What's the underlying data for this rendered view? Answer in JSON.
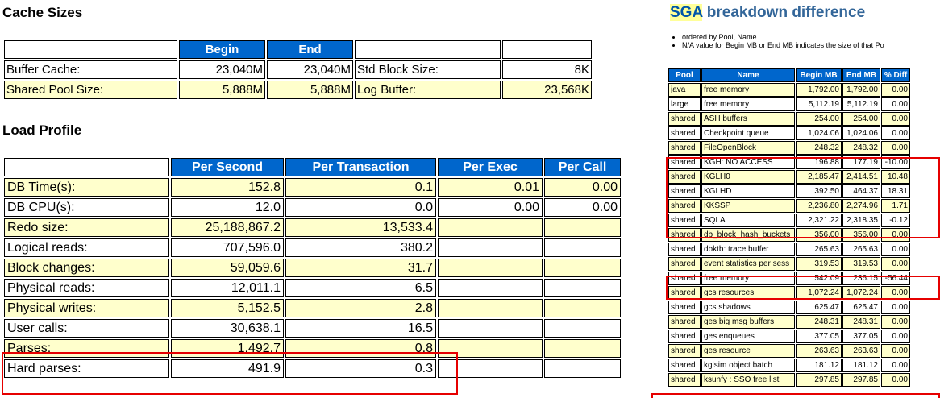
{
  "cache_sizes": {
    "title": "Cache Sizes",
    "headers": [
      "Begin",
      "End"
    ],
    "rows": [
      {
        "label": "Buffer Cache:",
        "begin": "23,040M",
        "end": "23,040M",
        "label2": "Std Block Size:",
        "value2": "8K",
        "shade": "w"
      },
      {
        "label": "Shared Pool Size:",
        "begin": "5,888M",
        "end": "5,888M",
        "label2": "Log Buffer:",
        "value2": "23,568K",
        "shade": "y"
      }
    ]
  },
  "load_profile": {
    "title": "Load Profile",
    "headers": [
      "Per Second",
      "Per Transaction",
      "Per Exec",
      "Per Call"
    ],
    "rows": [
      {
        "label": "DB Time(s):",
        "per_second": "152.8",
        "per_txn": "0.1",
        "per_exec": "0.01",
        "per_call": "0.00",
        "shade": "y"
      },
      {
        "label": "DB CPU(s):",
        "per_second": "12.0",
        "per_txn": "0.0",
        "per_exec": "0.00",
        "per_call": "0.00",
        "shade": "w"
      },
      {
        "label": "Redo size:",
        "per_second": "25,188,867.2",
        "per_txn": "13,533.4",
        "per_exec": "",
        "per_call": "",
        "shade": "y"
      },
      {
        "label": "Logical reads:",
        "per_second": "707,596.0",
        "per_txn": "380.2",
        "per_exec": "",
        "per_call": "",
        "shade": "w"
      },
      {
        "label": "Block changes:",
        "per_second": "59,059.6",
        "per_txn": "31.7",
        "per_exec": "",
        "per_call": "",
        "shade": "y"
      },
      {
        "label": "Physical reads:",
        "per_second": "12,011.1",
        "per_txn": "6.5",
        "per_exec": "",
        "per_call": "",
        "shade": "w"
      },
      {
        "label": "Physical writes:",
        "per_second": "5,152.5",
        "per_txn": "2.8",
        "per_exec": "",
        "per_call": "",
        "shade": "y"
      },
      {
        "label": "User calls:",
        "per_second": "30,638.1",
        "per_txn": "16.5",
        "per_exec": "",
        "per_call": "",
        "shade": "w"
      },
      {
        "label": "Parses:",
        "per_second": "1,492.7",
        "per_txn": "0.8",
        "per_exec": "",
        "per_call": "",
        "shade": "y"
      },
      {
        "label": "Hard parses:",
        "per_second": "491.9",
        "per_txn": "0.3",
        "per_exec": "",
        "per_call": "",
        "shade": "w"
      }
    ]
  },
  "sga_breakdown": {
    "title_highlight": "SGA",
    "title_rest": " breakdown difference",
    "notes": [
      "ordered by Pool, Name",
      "N/A value for Begin MB or End MB indicates the size of that Po"
    ],
    "headers": [
      "Pool",
      "Name",
      "Begin MB",
      "End MB",
      "% Diff"
    ],
    "rows": [
      {
        "pool": "java",
        "name": "free memory",
        "begin": "1,792.00",
        "end": "1,792.00",
        "diff": "0.00",
        "shade": "y"
      },
      {
        "pool": "large",
        "name": "free memory",
        "begin": "5,112.19",
        "end": "5,112.19",
        "diff": "0.00",
        "shade": "w"
      },
      {
        "pool": "shared",
        "name": "ASH buffers",
        "begin": "254.00",
        "end": "254.00",
        "diff": "0.00",
        "shade": "y"
      },
      {
        "pool": "shared",
        "name": "Checkpoint queue",
        "begin": "1,024.06",
        "end": "1,024.06",
        "diff": "0.00",
        "shade": "w"
      },
      {
        "pool": "shared",
        "name": "FileOpenBlock",
        "begin": "248.32",
        "end": "248.32",
        "diff": "0.00",
        "shade": "y"
      },
      {
        "pool": "shared",
        "name": "KGH: NO ACCESS",
        "begin": "196.88",
        "end": "177.19",
        "diff": "-10.00",
        "shade": "w"
      },
      {
        "pool": "shared",
        "name": "KGLH0",
        "begin": "2,185.47",
        "end": "2,414.51",
        "diff": "10.48",
        "shade": "y"
      },
      {
        "pool": "shared",
        "name": "KGLHD",
        "begin": "392.50",
        "end": "464.37",
        "diff": "18.31",
        "shade": "w"
      },
      {
        "pool": "shared",
        "name": "KKSSP",
        "begin": "2,236.80",
        "end": "2,274.96",
        "diff": "1.71",
        "shade": "y"
      },
      {
        "pool": "shared",
        "name": "SQLA",
        "begin": "2,321.22",
        "end": "2,318.35",
        "diff": "-0.12",
        "shade": "w"
      },
      {
        "pool": "shared",
        "name": "db_block_hash_buckets",
        "begin": "356.00",
        "end": "356.00",
        "diff": "0.00",
        "shade": "y"
      },
      {
        "pool": "shared",
        "name": "dbktb: trace buffer",
        "begin": "265.63",
        "end": "265.63",
        "diff": "0.00",
        "shade": "w"
      },
      {
        "pool": "shared",
        "name": "event statistics per sess",
        "begin": "319.53",
        "end": "319.53",
        "diff": "0.00",
        "shade": "y"
      },
      {
        "pool": "shared",
        "name": "free memory",
        "begin": "542.09",
        "end": "236.15",
        "diff": "-56.44",
        "shade": "w"
      },
      {
        "pool": "shared",
        "name": "gcs resources",
        "begin": "1,072.24",
        "end": "1,072.24",
        "diff": "0.00",
        "shade": "y"
      },
      {
        "pool": "shared",
        "name": "gcs shadows",
        "begin": "625.47",
        "end": "625.47",
        "diff": "0.00",
        "shade": "w"
      },
      {
        "pool": "shared",
        "name": "ges big msg buffers",
        "begin": "248.31",
        "end": "248.31",
        "diff": "0.00",
        "shade": "y"
      },
      {
        "pool": "shared",
        "name": "ges enqueues",
        "begin": "377.05",
        "end": "377.05",
        "diff": "0.00",
        "shade": "w"
      },
      {
        "pool": "shared",
        "name": "ges resource",
        "begin": "263.63",
        "end": "263.63",
        "diff": "0.00",
        "shade": "y"
      },
      {
        "pool": "shared",
        "name": "kglsim object batch",
        "begin": "181.12",
        "end": "181.12",
        "diff": "0.00",
        "shade": "w"
      },
      {
        "pool": "shared",
        "name": "ksunfy : SSO free list",
        "begin": "297.85",
        "end": "297.85",
        "diff": "0.00",
        "shade": "y"
      }
    ]
  },
  "colors": {
    "header_bg": "#0066CC",
    "row_highlight": "#FFFFCC",
    "annotation_box": "#E60000",
    "sga_title": "#336699"
  }
}
